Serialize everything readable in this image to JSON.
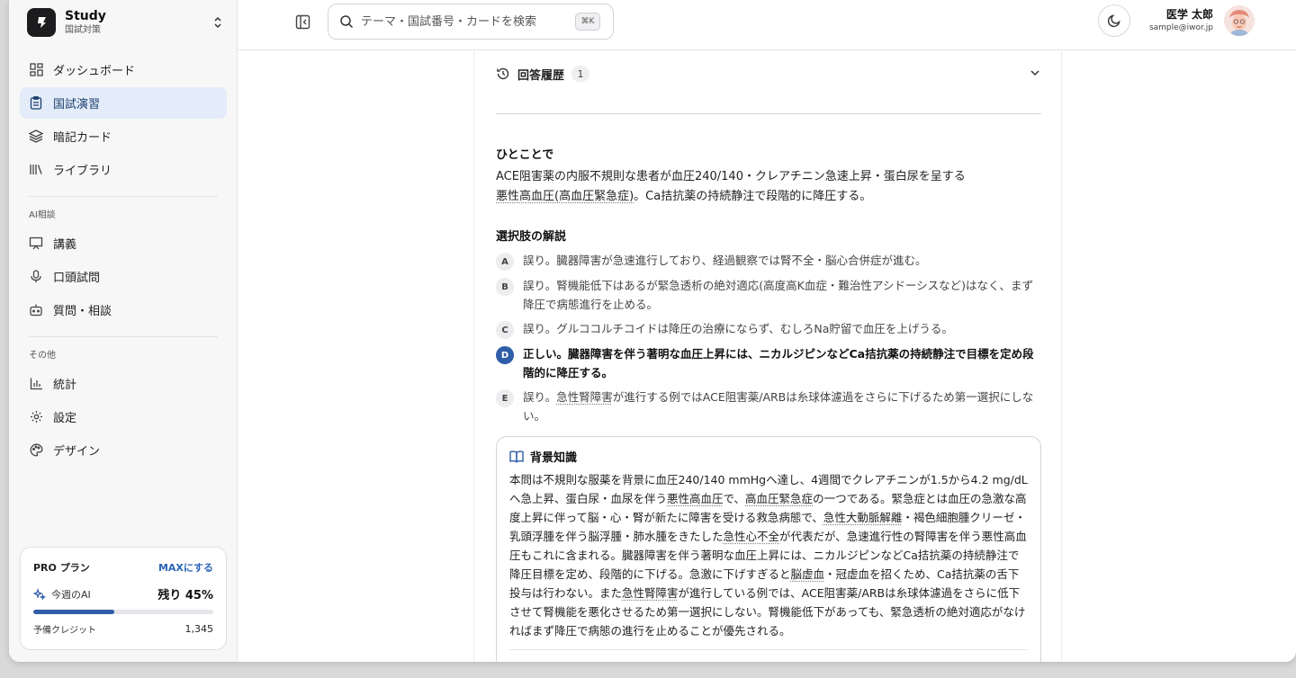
{
  "brand": {
    "title": "Study",
    "subtitle": "国試対策"
  },
  "nav": {
    "items": [
      {
        "label": "ダッシュボード",
        "icon": "grid-icon"
      },
      {
        "label": "国試演習",
        "icon": "clipboard-icon",
        "active": true
      },
      {
        "label": "暗記カード",
        "icon": "layers-icon"
      },
      {
        "label": "ライブラリ",
        "icon": "library-icon"
      }
    ],
    "section_ai": "AI相談",
    "ai_items": [
      {
        "label": "講義",
        "icon": "presentation-icon"
      },
      {
        "label": "口頭試問",
        "icon": "mic-icon"
      },
      {
        "label": "質問・相談",
        "icon": "bot-icon"
      }
    ],
    "section_other": "その他",
    "other_items": [
      {
        "label": "統計",
        "icon": "bar-chart-icon"
      },
      {
        "label": "設定",
        "icon": "gear-icon"
      },
      {
        "label": "デザイン",
        "icon": "palette-icon"
      }
    ]
  },
  "plan": {
    "name": "PRO プラン",
    "upgrade_label": "MAXにする",
    "ai_label": "今週のAI",
    "remaining": "残り 45%",
    "remaining_fraction": 0.45,
    "credit_label": "予備クレジット",
    "credit_value": "1,345"
  },
  "header": {
    "search_placeholder": "テーマ・国試番号・カードを検索",
    "shortcut": "⌘K",
    "user_name": "医学 太郎",
    "user_email": "sample@iwor.jp"
  },
  "history": {
    "label": "回答履歴",
    "count": "1"
  },
  "summary": {
    "title": "ひとことで",
    "line1": "ACE阻害薬の内服不規則な患者が血圧240/140・クレアチニン急速上昇・蛋白尿を呈する",
    "term": "悪性高血圧(高血圧緊急症)",
    "line2_rest": "。Ca拮抗薬の持続静注で段階的に降圧する。"
  },
  "choices": {
    "title": "選択肢の解説",
    "items": [
      {
        "key": "A",
        "text": "誤り。臓器障害が急速進行しており、経過観察では腎不全・脳心合併症が進む。"
      },
      {
        "key": "B",
        "text": "誤り。腎機能低下はあるが緊急透析の絶対適応(高度高K血症・難治性アシドーシスなど)はなく、まず降圧で病態進行を止める。"
      },
      {
        "key": "C",
        "text": "誤り。グルココルチコイドは降圧の治療にならず、むしろNa貯留で血圧を上げうる。"
      },
      {
        "key": "D",
        "text": "正しい。臓器障害を伴う著明な血圧上昇には、ニカルジピンなどCa拮抗薬の持続静注で目標を定め段階的に降圧する。",
        "correct": true
      },
      {
        "key": "E",
        "pre": "誤り。",
        "term": "急性腎障害",
        "post": "が進行する例ではACE阻害薬/ARBは糸球体濾過をさらに下げるため第一選択にしない。"
      }
    ]
  },
  "background": {
    "title": "背景知識",
    "p1": "本問は不規則な服薬を背景に血圧240/140 mmHgへ達し、4週間でクレアチニンが1.5から4.2 mg/dLへ急上昇、蛋白尿・血尿を伴う",
    "t1": "悪性高血圧",
    "p2": "で、",
    "t2": "高血圧緊急症",
    "p3": "の一つである。緊急症とは血圧の急激な高度上昇に伴って脳・心・腎が新たに障害を受ける救急病態で、",
    "t3": "急性大動脈解離",
    "p4": "・褐色細胞腫クリーゼ・乳頭浮腫を伴う脳浮腫・肺水腫をきたした",
    "t4": "急性心不全",
    "p5": "が代表だが、急速進行性の腎障害を伴う悪性高血圧もこれに含まれる。臓器障害を伴う著明な血圧上昇には、ニカルジピンなどCa拮抗薬の持続静注で降圧目標を定め、段階的に下げる。急激に下げすぎると",
    "t5": "脳虚血",
    "p6": "・冠虚血を招くため、Ca拮抗薬の舌下投与は行わない。また",
    "t6": "急性腎障害",
    "p7": "が進行している例では、ACE阻害薬/ARBは糸球体濾過をさらに低下させて腎機能を悪化させるため第一選択にしない。腎機能低下があっても、緊急透析の絶対適応がなければまず降圧で病態の進行を止めることが優先される。"
  },
  "colors": {
    "accent": "#2f5da8",
    "active_bg": "#e3ecf8",
    "sidebar_bg": "#f7f7f8"
  }
}
